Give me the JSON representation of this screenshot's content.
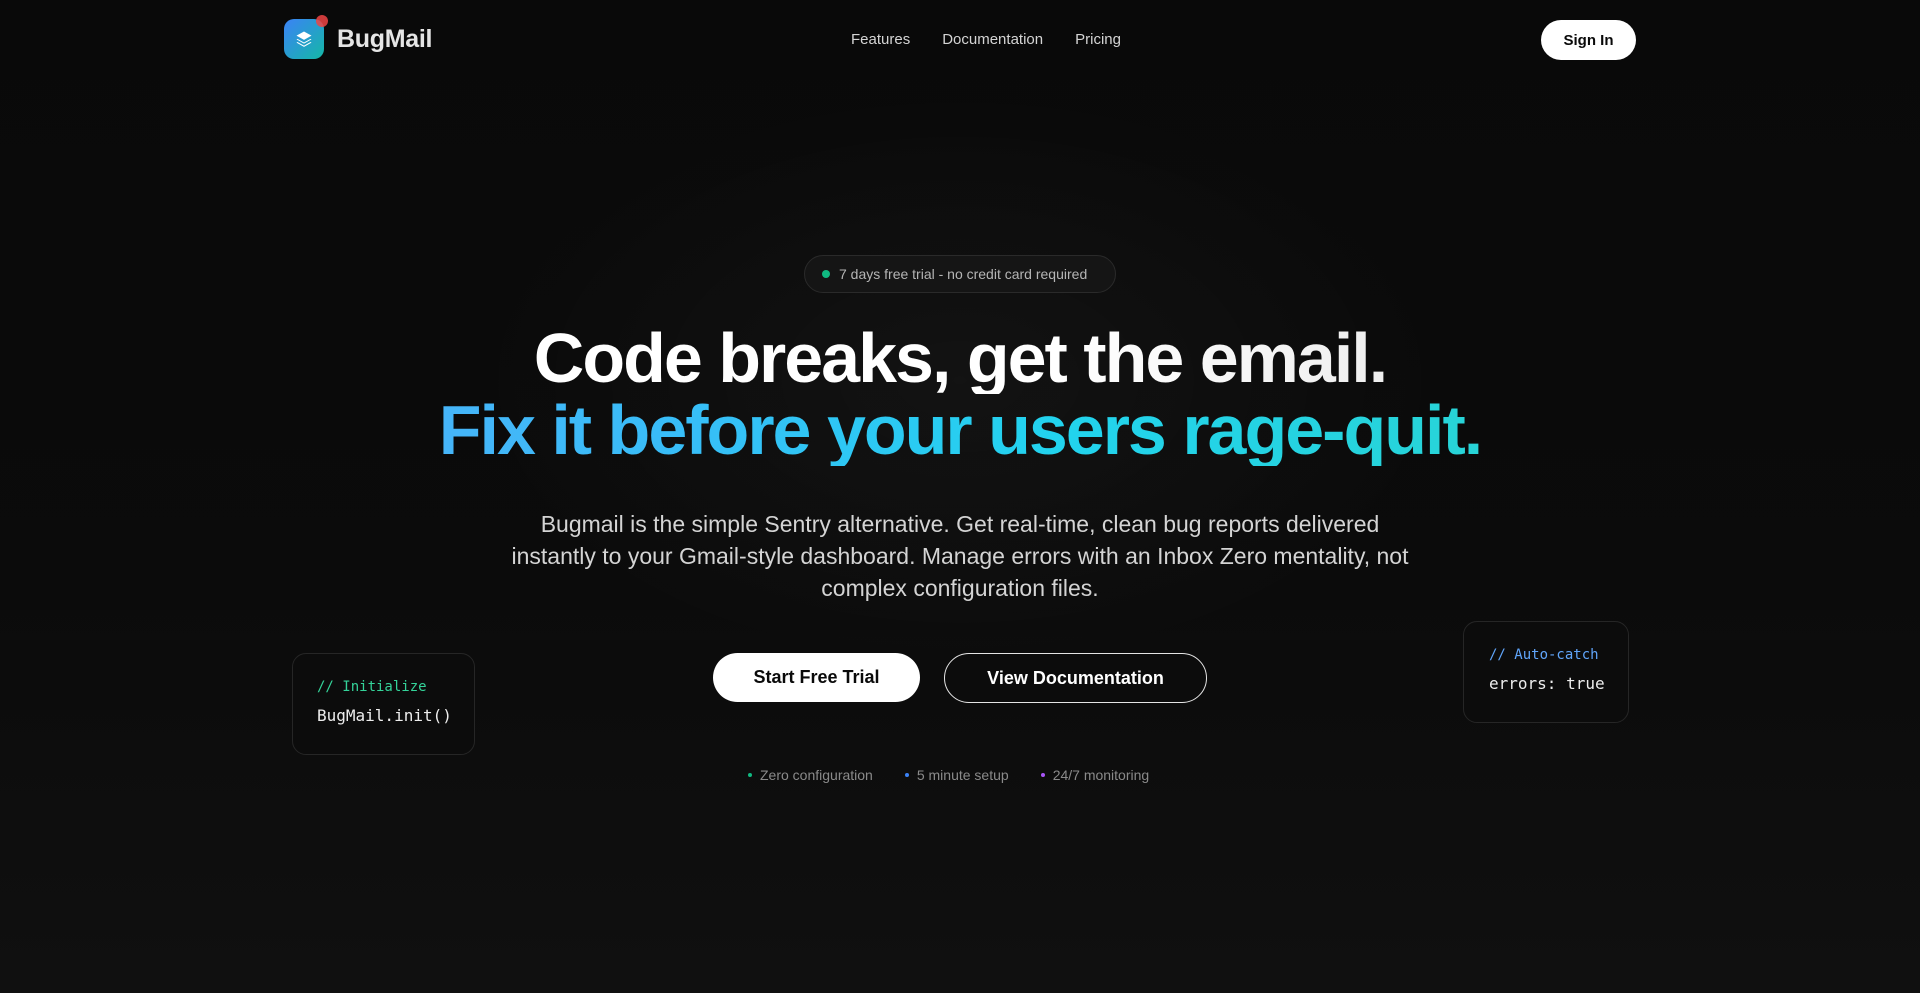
{
  "brand": {
    "name": "BugMail",
    "logo_icon": "layers-icon",
    "logo_gradient": [
      "#3b82f6",
      "#14b8a6"
    ],
    "notification_dot_color": "#ef4444"
  },
  "nav": {
    "links": [
      {
        "label": "Features"
      },
      {
        "label": "Documentation"
      },
      {
        "label": "Pricing"
      }
    ],
    "signin_label": "Sign In"
  },
  "hero": {
    "badge": {
      "text": "7 days free trial - no credit card required",
      "dot_color": "#10b981"
    },
    "headline_line1": "Code breaks, get the email.",
    "headline_line2": "Fix it before your users rage-quit.",
    "subcopy": "Bugmail is the simple Sentry alternative. Get real-time, clean bug reports delivered instantly to your Gmail-style dashboard. Manage errors with an Inbox Zero mentality, not complex configuration files.",
    "cta_primary": "Start Free Trial",
    "cta_secondary": "View Documentation",
    "features": [
      {
        "label": "Zero configuration",
        "dot_color": "#10b981"
      },
      {
        "label": "5 minute setup",
        "dot_color": "#3b82f6"
      },
      {
        "label": "24/7 monitoring",
        "dot_color": "#a855f7"
      }
    ]
  },
  "code_cards": {
    "left": {
      "comment": "// Initialize",
      "comment_color": "#34d399",
      "code": "BugMail.init()"
    },
    "right": {
      "comment": "// Auto-catch",
      "comment_color": "#60a5fa",
      "code": "errors: true"
    }
  }
}
